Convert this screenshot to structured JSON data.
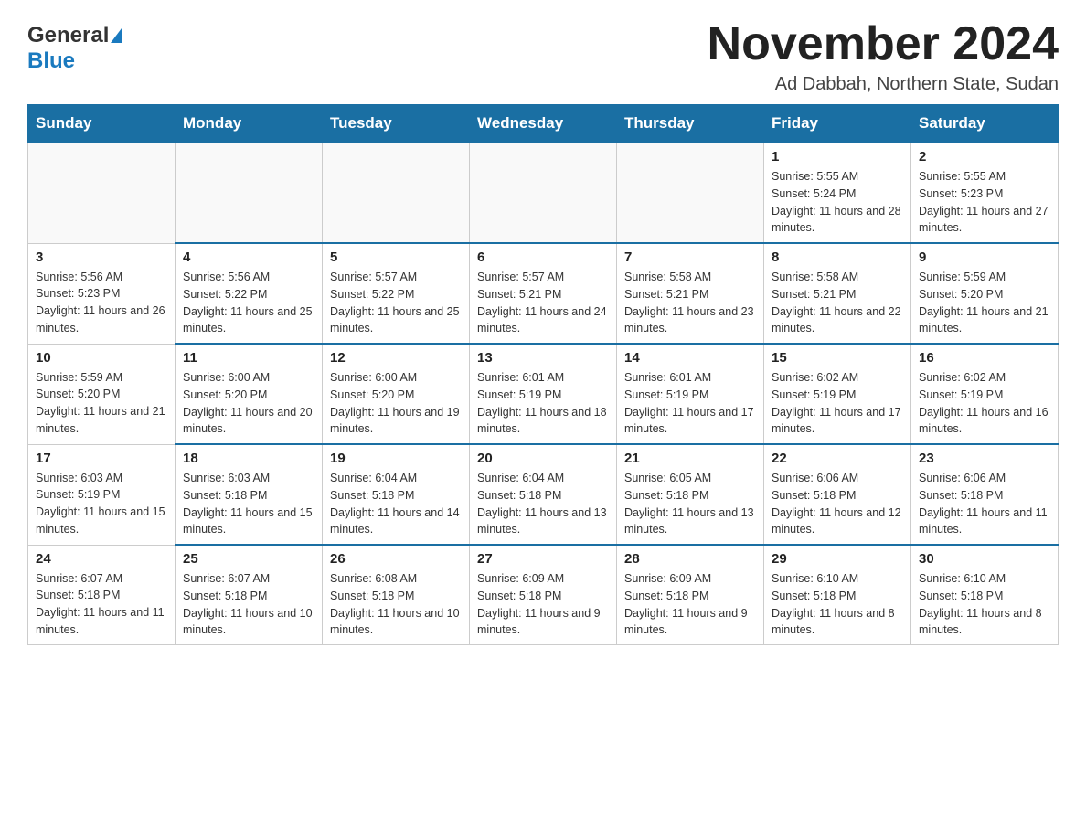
{
  "header": {
    "title": "November 2024",
    "subtitle": "Ad Dabbah, Northern State, Sudan",
    "logo_general": "General",
    "logo_blue": "Blue"
  },
  "days_of_week": [
    "Sunday",
    "Monday",
    "Tuesday",
    "Wednesday",
    "Thursday",
    "Friday",
    "Saturday"
  ],
  "weeks": [
    [
      {
        "num": "",
        "info": ""
      },
      {
        "num": "",
        "info": ""
      },
      {
        "num": "",
        "info": ""
      },
      {
        "num": "",
        "info": ""
      },
      {
        "num": "",
        "info": ""
      },
      {
        "num": "1",
        "info": "Sunrise: 5:55 AM\nSunset: 5:24 PM\nDaylight: 11 hours and 28 minutes."
      },
      {
        "num": "2",
        "info": "Sunrise: 5:55 AM\nSunset: 5:23 PM\nDaylight: 11 hours and 27 minutes."
      }
    ],
    [
      {
        "num": "3",
        "info": "Sunrise: 5:56 AM\nSunset: 5:23 PM\nDaylight: 11 hours and 26 minutes."
      },
      {
        "num": "4",
        "info": "Sunrise: 5:56 AM\nSunset: 5:22 PM\nDaylight: 11 hours and 25 minutes."
      },
      {
        "num": "5",
        "info": "Sunrise: 5:57 AM\nSunset: 5:22 PM\nDaylight: 11 hours and 25 minutes."
      },
      {
        "num": "6",
        "info": "Sunrise: 5:57 AM\nSunset: 5:21 PM\nDaylight: 11 hours and 24 minutes."
      },
      {
        "num": "7",
        "info": "Sunrise: 5:58 AM\nSunset: 5:21 PM\nDaylight: 11 hours and 23 minutes."
      },
      {
        "num": "8",
        "info": "Sunrise: 5:58 AM\nSunset: 5:21 PM\nDaylight: 11 hours and 22 minutes."
      },
      {
        "num": "9",
        "info": "Sunrise: 5:59 AM\nSunset: 5:20 PM\nDaylight: 11 hours and 21 minutes."
      }
    ],
    [
      {
        "num": "10",
        "info": "Sunrise: 5:59 AM\nSunset: 5:20 PM\nDaylight: 11 hours and 21 minutes."
      },
      {
        "num": "11",
        "info": "Sunrise: 6:00 AM\nSunset: 5:20 PM\nDaylight: 11 hours and 20 minutes."
      },
      {
        "num": "12",
        "info": "Sunrise: 6:00 AM\nSunset: 5:20 PM\nDaylight: 11 hours and 19 minutes."
      },
      {
        "num": "13",
        "info": "Sunrise: 6:01 AM\nSunset: 5:19 PM\nDaylight: 11 hours and 18 minutes."
      },
      {
        "num": "14",
        "info": "Sunrise: 6:01 AM\nSunset: 5:19 PM\nDaylight: 11 hours and 17 minutes."
      },
      {
        "num": "15",
        "info": "Sunrise: 6:02 AM\nSunset: 5:19 PM\nDaylight: 11 hours and 17 minutes."
      },
      {
        "num": "16",
        "info": "Sunrise: 6:02 AM\nSunset: 5:19 PM\nDaylight: 11 hours and 16 minutes."
      }
    ],
    [
      {
        "num": "17",
        "info": "Sunrise: 6:03 AM\nSunset: 5:19 PM\nDaylight: 11 hours and 15 minutes."
      },
      {
        "num": "18",
        "info": "Sunrise: 6:03 AM\nSunset: 5:18 PM\nDaylight: 11 hours and 15 minutes."
      },
      {
        "num": "19",
        "info": "Sunrise: 6:04 AM\nSunset: 5:18 PM\nDaylight: 11 hours and 14 minutes."
      },
      {
        "num": "20",
        "info": "Sunrise: 6:04 AM\nSunset: 5:18 PM\nDaylight: 11 hours and 13 minutes."
      },
      {
        "num": "21",
        "info": "Sunrise: 6:05 AM\nSunset: 5:18 PM\nDaylight: 11 hours and 13 minutes."
      },
      {
        "num": "22",
        "info": "Sunrise: 6:06 AM\nSunset: 5:18 PM\nDaylight: 11 hours and 12 minutes."
      },
      {
        "num": "23",
        "info": "Sunrise: 6:06 AM\nSunset: 5:18 PM\nDaylight: 11 hours and 11 minutes."
      }
    ],
    [
      {
        "num": "24",
        "info": "Sunrise: 6:07 AM\nSunset: 5:18 PM\nDaylight: 11 hours and 11 minutes."
      },
      {
        "num": "25",
        "info": "Sunrise: 6:07 AM\nSunset: 5:18 PM\nDaylight: 11 hours and 10 minutes."
      },
      {
        "num": "26",
        "info": "Sunrise: 6:08 AM\nSunset: 5:18 PM\nDaylight: 11 hours and 10 minutes."
      },
      {
        "num": "27",
        "info": "Sunrise: 6:09 AM\nSunset: 5:18 PM\nDaylight: 11 hours and 9 minutes."
      },
      {
        "num": "28",
        "info": "Sunrise: 6:09 AM\nSunset: 5:18 PM\nDaylight: 11 hours and 9 minutes."
      },
      {
        "num": "29",
        "info": "Sunrise: 6:10 AM\nSunset: 5:18 PM\nDaylight: 11 hours and 8 minutes."
      },
      {
        "num": "30",
        "info": "Sunrise: 6:10 AM\nSunset: 5:18 PM\nDaylight: 11 hours and 8 minutes."
      }
    ]
  ]
}
